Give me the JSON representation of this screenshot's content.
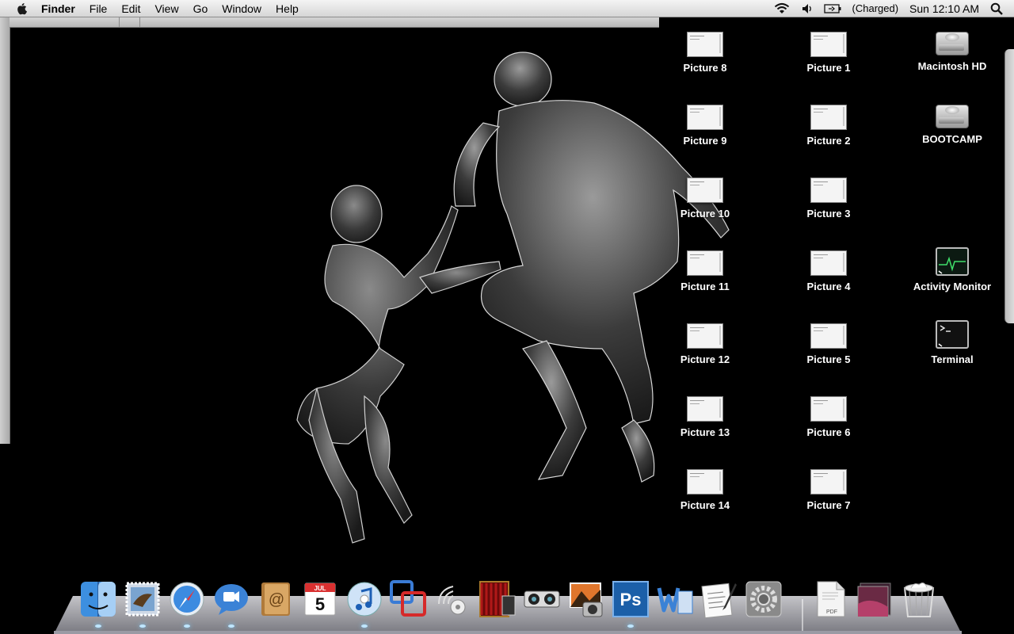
{
  "menubar": {
    "app_name": "Finder",
    "menus": [
      "File",
      "Edit",
      "View",
      "Go",
      "Window",
      "Help"
    ],
    "battery_status": "(Charged)",
    "clock": "Sun 12:10 AM"
  },
  "desktop": {
    "col1": [
      "Picture 8",
      "Picture 9",
      "Picture 10",
      "Picture 11",
      "Picture 12",
      "Picture 13",
      "Picture 14"
    ],
    "col2": [
      "Picture 1",
      "Picture 2",
      "Picture 3",
      "Picture 4",
      "Picture 5",
      "Picture 6",
      "Picture 7"
    ],
    "drives": [
      "Macintosh HD",
      "BOOTCAMP"
    ],
    "apps": [
      "Activity Monitor",
      "Terminal"
    ]
  },
  "dock": {
    "calendar_month": "JUL",
    "calendar_day": "5",
    "photoshop_label": "Ps",
    "pdf_label": "PDF",
    "items": [
      "finder",
      "mail",
      "safari",
      "ichat",
      "address-book",
      "ical",
      "itunes",
      "vmware",
      "airport-utility",
      "front-row",
      "photo-booth",
      "iphoto",
      "photoshop",
      "word",
      "textedit",
      "system-preferences",
      "pdf-document",
      "downloads-stack",
      "trash"
    ]
  }
}
